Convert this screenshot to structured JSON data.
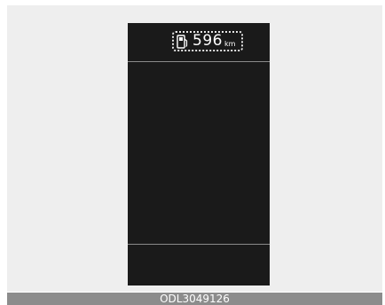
{
  "display": {
    "range_value": "596",
    "range_unit": "km",
    "fuel_icon": "fuel-pump-icon"
  },
  "caption": {
    "code": "ODL3049126"
  },
  "colors": {
    "display_bg": "#1a1a1a",
    "frame_bg": "#eeeeee",
    "caption_bg": "#8c8c8c",
    "text": "#ffffff"
  }
}
